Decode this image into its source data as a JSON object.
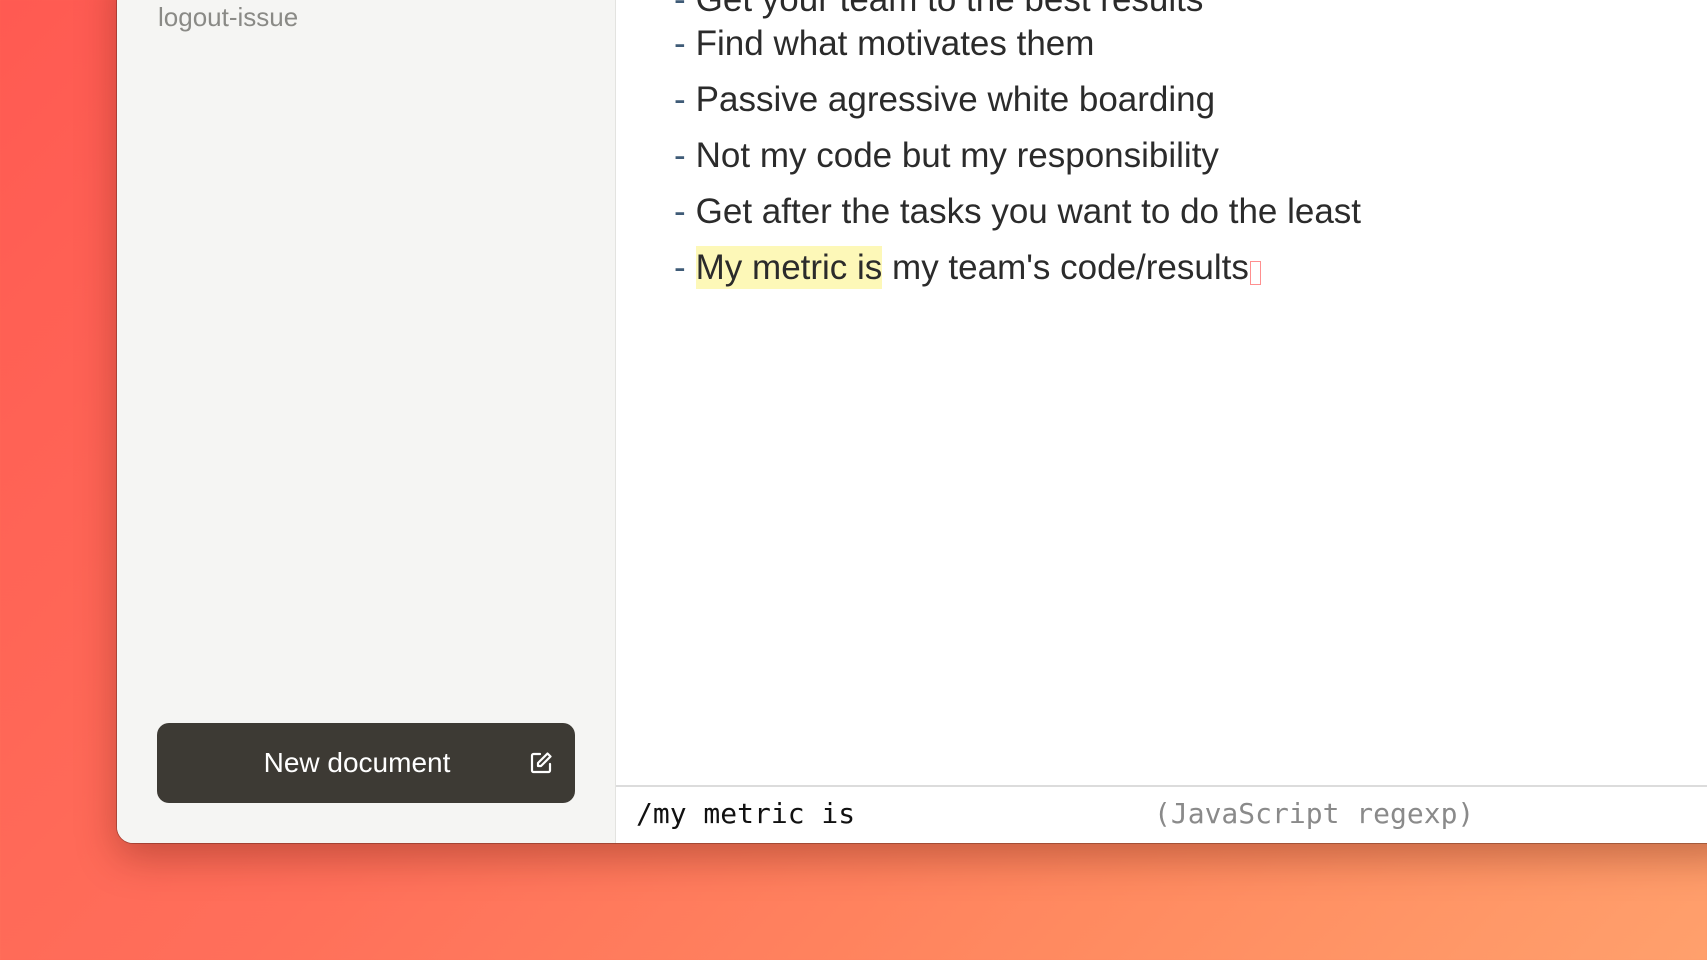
{
  "sidebar": {
    "items": [
      {
        "label": "logout-issue"
      }
    ],
    "new_document_label": "New document",
    "new_document_icon": "compose-icon"
  },
  "editor": {
    "lines": [
      {
        "dash": "-",
        "text": "Get your team to the best results"
      },
      {
        "dash": "-",
        "text": "Find what motivates them"
      },
      {
        "dash": "-",
        "text": "Passive agressive white boarding"
      },
      {
        "dash": "-",
        "text": "Not my code but my responsibility"
      },
      {
        "dash": "-",
        "text": "Get after the tasks you want to do the least"
      },
      {
        "dash": "-",
        "match": "My metric is",
        "rest": " my team's code/results"
      }
    ]
  },
  "search": {
    "query": "/my metric is",
    "hint": "(JavaScript regexp)"
  },
  "colors": {
    "highlight": "#fdf8b8",
    "button_bg": "#3d3a34",
    "cursor": "#ff8f8f"
  }
}
